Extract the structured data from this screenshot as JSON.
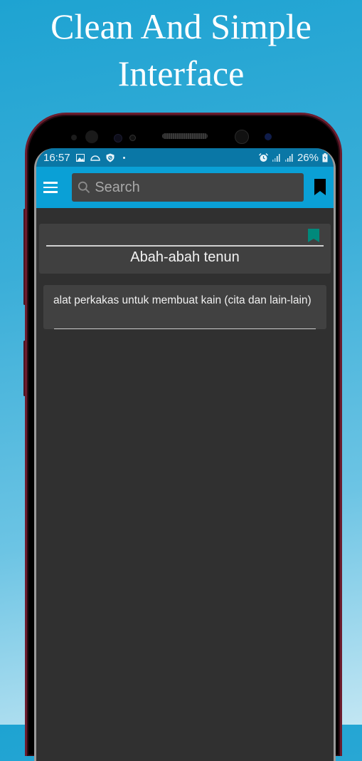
{
  "promo": {
    "headline_line1": "Clean And Simple",
    "headline_line2": "Interface"
  },
  "status_bar": {
    "time": "16:57",
    "left_icons": [
      "image-icon",
      "cloud-icon",
      "shield-icon",
      "dot-icon"
    ],
    "right_icons": [
      "alarm-icon",
      "signal-icon",
      "signal-icon"
    ],
    "battery": "26%"
  },
  "toolbar": {
    "menu_icon": "hamburger-menu-icon",
    "search_placeholder": "Search",
    "search_value": "",
    "bookmark_icon": "bookmark-icon"
  },
  "entry": {
    "word": "Abah-abah tenun",
    "definition": "alat perkakas untuk membuat kain (cita dan lain-lain)",
    "bookmark_color": "#00897b"
  },
  "colors": {
    "statusbar": "#0a77a6",
    "toolbar": "#0aa0d6",
    "background": "#303030",
    "card": "#404040"
  }
}
